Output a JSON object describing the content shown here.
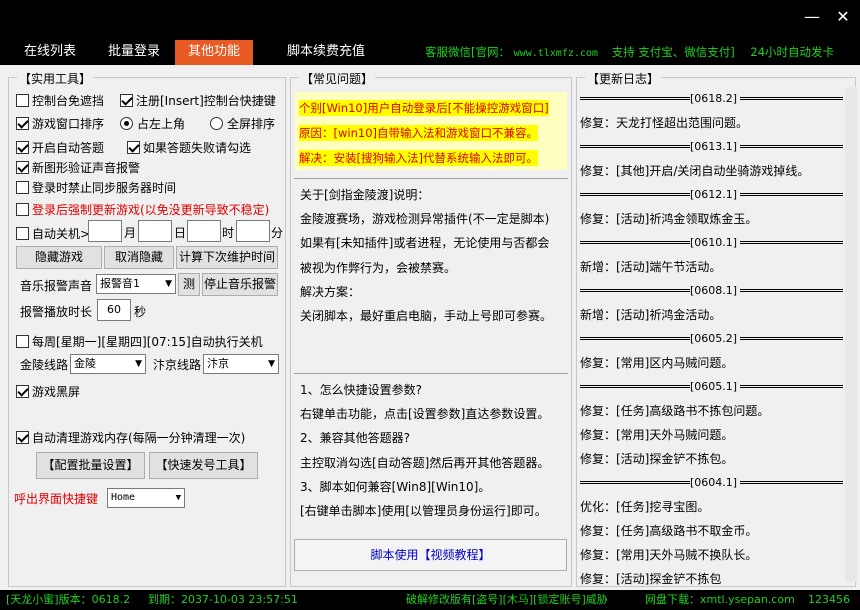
{
  "window": {
    "minimize_glyph": "—",
    "close_glyph": "✕"
  },
  "tabs": [
    {
      "label": "在线列表"
    },
    {
      "label": "批量登录"
    },
    {
      "label": "其他功能"
    },
    {
      "label": "脚本续费充值"
    }
  ],
  "service": {
    "label": "客服微信[官网：",
    "site": "www.tlxmfz.com",
    "payment": "支持 支付宝、微信支付]",
    "hours": "24小时自动发卡"
  },
  "tools": {
    "title": "【实用工具】",
    "console_free": "控制台免遮挡",
    "register_hotkey": "注册[Insert]控制台快捷键",
    "window_sort": "游戏窗口排序",
    "top_left": "占左上角",
    "full_screen_sort": "全屏排序",
    "auto_answer": "开启自动答题",
    "answer_fail": "如果答题失败请勾选",
    "captcha_alarm": "新图形验证声音报警",
    "no_sync_time": "登录时禁止同步服务器时间",
    "force_update": "登录后强制更新游戏(以免没更新导致不稳定)",
    "auto_shutdown": "自动关机>",
    "month": "月",
    "day": "日",
    "hour": "时",
    "minute": "分",
    "hide_game": "隐藏游戏",
    "cancel_hide": "取消隐藏",
    "calc_maint": "计算下次维护时间",
    "alarm_sound_label": "音乐报警声音",
    "alarm_sound": "报警音1",
    "test": "测",
    "stop_alarm": "停止音乐报警",
    "alarm_duration_label": "报警播放时长",
    "alarm_duration": "60",
    "seconds": "秒",
    "weekly_shutdown": "每周[星期一][星期四][07:15]自动执行关机",
    "jinling_label": "金陵线路",
    "jinling_value": "金陵",
    "bianjing_label": "汴京线路",
    "bianjing_value": "汴京",
    "black_screen": "游戏黑屏",
    "auto_clean": "自动清理游戏内存(每隔一分钟清理一次)",
    "batch_settings": "【配置批量设置】",
    "quick_tool": "【快速发号工具】",
    "hotkey_label": "呼出界面快捷键",
    "hotkey_value": "Home"
  },
  "faq": {
    "title": "【常见问题】",
    "top": [
      "个别[Win10]用户自动登录后[不能操控游戏窗口]",
      "原因：[win10]自带输入法和游戏窗口不兼容。",
      "解决：安装[搜狗输入法]代替系统输入法即可。"
    ],
    "mid": [
      "关于[剑指金陵渡]说明：",
      "金陵渡赛场，游戏检测异常插件(不一定是脚本)",
      "如果有[未知插件]或者进程，无论使用与否都会",
      "被视为作弊行为，会被禁赛。",
      "解决方案：",
      "关闭脚本，最好重启电脑，手动上号即可参赛。"
    ],
    "bottom": [
      "1、怎么快捷设置参数?",
      "右键单击功能，点击[设置参数]直达参数设置。",
      "2、兼容其他答题器?",
      "主控取消勾选[自动答题]然后再开其他答题器。",
      "3、脚本如何兼容[Win8][Win10]。",
      "[右键单击脚本]使用[以管理员身份运行]即可。"
    ],
    "video_button": "脚本使用【视频教程】"
  },
  "changelog": {
    "title": "【更新日志】",
    "entries": [
      {
        "date": "[0618.2]",
        "items": [
          "修复：天龙打怪超出范围问题。"
        ]
      },
      {
        "date": "[0613.1]",
        "items": [
          "修复：[其他]开启/关闭自动坐骑游戏掉线。"
        ]
      },
      {
        "date": "[0612.1]",
        "items": [
          "修复：[活动]祈鸿金领取炼金玉。"
        ]
      },
      {
        "date": "[0610.1]",
        "items": [
          "新增：[活动]端午节活动。"
        ]
      },
      {
        "date": "[0608.1]",
        "items": [
          "新增：[活动]祈鸿金活动。"
        ]
      },
      {
        "date": "[0605.2]",
        "items": [
          "修复：[常用]区内马贼问题。"
        ]
      },
      {
        "date": "[0605.1]",
        "items": [
          "修复：[任务]高级路书不拣包问题。",
          "修复：[常用]天外马贼问题。",
          "修复：[活动]探金铲不拣包。"
        ]
      },
      {
        "date": "[0604.1]",
        "items": [
          "优化：[任务]挖寻宝图。",
          "修复：[任务]高级路书不取金币。",
          "修复：[常用]天外马贼不换队长。",
          "修复：[活动]探金铲不拣包"
        ]
      }
    ]
  },
  "status": {
    "version": "[天龙小蜜]版本：0618.2",
    "expiry": "到期：2037-10-03 23:57:51",
    "warning": "破解修改版有[盗号][木马][锁定账号]威胁",
    "download": "网盘下载：xmtl.ysepan.com",
    "code": "123456"
  },
  "colors": {
    "accent": "#e85a23",
    "service_green": "#1ed11e",
    "warn_red": "#e00000",
    "link_blue": "#0000cc"
  }
}
